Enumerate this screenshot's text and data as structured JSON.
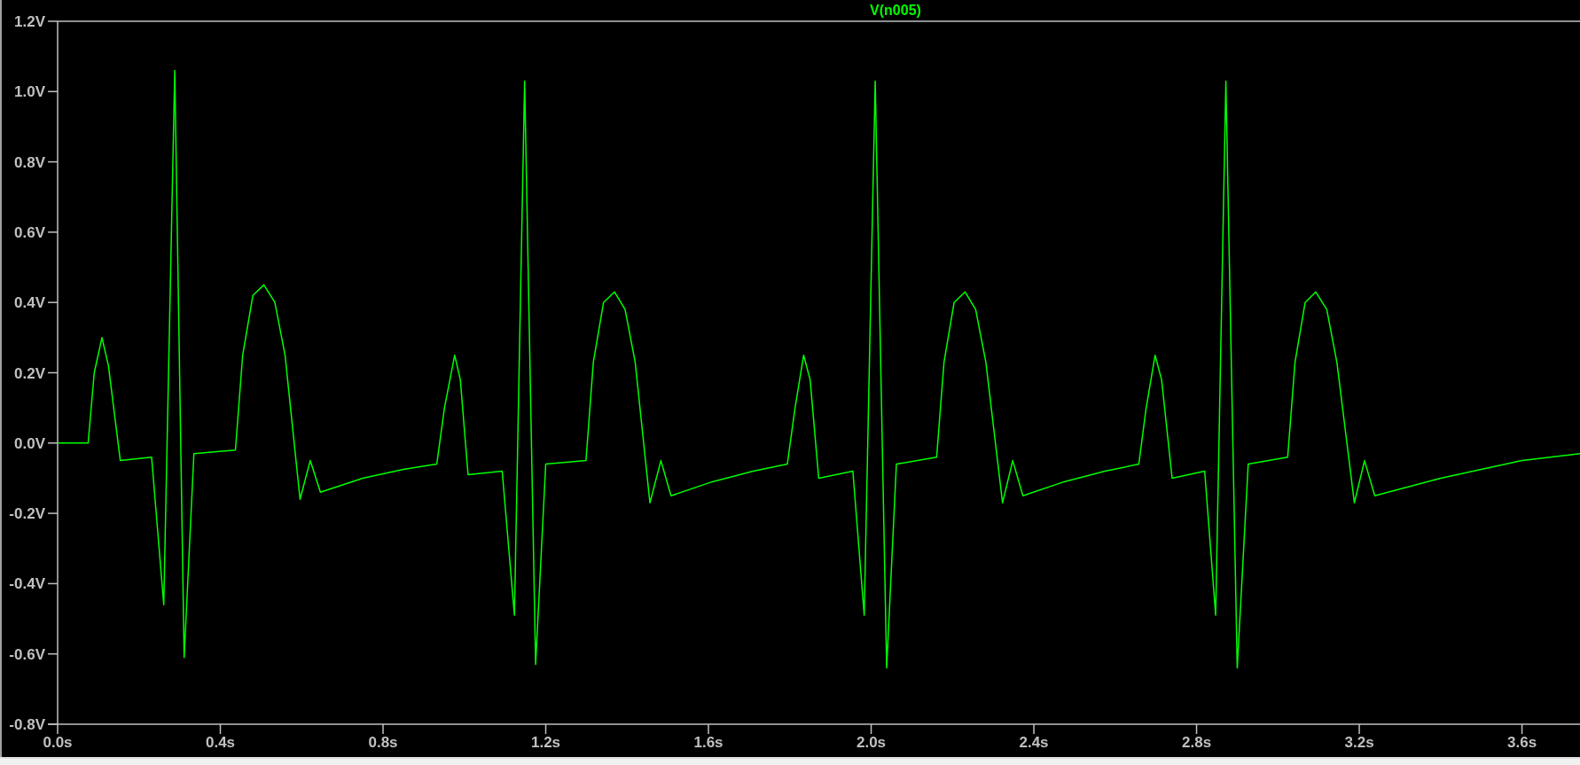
{
  "plot": {
    "chart_data": {
      "type": "line",
      "x": [
        0,
        0.075,
        0.09,
        0.109,
        0.125,
        0.154,
        0.231,
        0.261,
        0.288,
        0.311,
        0.335,
        0.437,
        0.455,
        0.48,
        0.507,
        0.534,
        0.559,
        0.596,
        0.621,
        0.646,
        0.75,
        0.85,
        0.932,
        0.951,
        0.976,
        0.99,
        1.009,
        1.093,
        1.123,
        1.148,
        1.175,
        1.2,
        1.299,
        1.317,
        1.342,
        1.369,
        1.395,
        1.42,
        1.456,
        1.483,
        1.508,
        1.61,
        1.71,
        1.794,
        1.813,
        1.834,
        1.85,
        1.871,
        1.955,
        1.983,
        2.01,
        2.038,
        2.062,
        2.161,
        2.179,
        2.204,
        2.231,
        2.257,
        2.282,
        2.323,
        2.348,
        2.373,
        2.475,
        2.575,
        2.658,
        2.676,
        2.698,
        2.714,
        2.74,
        2.82,
        2.847,
        2.872,
        2.9,
        2.927,
        3.024,
        3.042,
        3.067,
        3.093,
        3.12,
        3.145,
        3.188,
        3.213,
        3.238,
        3.4,
        3.6,
        3.745
      ],
      "series": [
        {
          "name": "V(n005)",
          "color": "#00ff00",
          "values": [
            0,
            0,
            0.2,
            0.3,
            0.22,
            -0.05,
            -0.04,
            -0.46,
            1.06,
            -0.61,
            -0.03,
            -0.02,
            0.25,
            0.42,
            0.45,
            0.4,
            0.25,
            -0.16,
            -0.05,
            -0.14,
            -0.1,
            -0.075,
            -0.06,
            0.1,
            0.25,
            0.18,
            -0.09,
            -0.08,
            -0.49,
            1.03,
            -0.63,
            -0.06,
            -0.05,
            0.23,
            0.4,
            0.43,
            0.38,
            0.23,
            -0.17,
            -0.05,
            -0.15,
            -0.11,
            -0.08,
            -0.06,
            0.1,
            0.25,
            0.18,
            -0.1,
            -0.08,
            -0.49,
            1.03,
            -0.64,
            -0.06,
            -0.04,
            0.23,
            0.4,
            0.43,
            0.38,
            0.23,
            -0.17,
            -0.05,
            -0.15,
            -0.11,
            -0.08,
            -0.06,
            0.1,
            0.25,
            0.18,
            -0.1,
            -0.08,
            -0.49,
            1.03,
            -0.64,
            -0.06,
            -0.04,
            0.23,
            0.4,
            0.43,
            0.38,
            0.23,
            -0.17,
            -0.05,
            -0.15,
            -0.1,
            -0.05,
            -0.03
          ]
        }
      ],
      "xlim": [
        0,
        3.747
      ],
      "ylim": [
        -0.8,
        1.2
      ],
      "xticks": [
        {
          "value": 0,
          "label": "0.0s"
        },
        {
          "value": 0.4,
          "label": "0.4s"
        },
        {
          "value": 0.8,
          "label": "0.8s"
        },
        {
          "value": 1.2,
          "label": "1.2s"
        },
        {
          "value": 1.6,
          "label": "1.6s"
        },
        {
          "value": 2.0,
          "label": "2.0s"
        },
        {
          "value": 2.4,
          "label": "2.4s"
        },
        {
          "value": 2.8,
          "label": "2.8s"
        },
        {
          "value": 3.2,
          "label": "3.2s"
        },
        {
          "value": 3.6,
          "label": "3.6s"
        }
      ],
      "yticks": [
        {
          "value": -0.8,
          "label": "-0.8V"
        },
        {
          "value": -0.6,
          "label": "-0.6V"
        },
        {
          "value": -0.4,
          "label": "-0.4V"
        },
        {
          "value": -0.2,
          "label": "-0.2V"
        },
        {
          "value": 0,
          "label": "0.0V"
        },
        {
          "value": 0.2,
          "label": "0.2V"
        },
        {
          "value": 0.4,
          "label": "0.4V"
        },
        {
          "value": 0.6,
          "label": "0.6V"
        },
        {
          "value": 0.8,
          "label": "0.8V"
        },
        {
          "value": 1.0,
          "label": "1.0V"
        },
        {
          "value": 1.2,
          "label": "1.2V"
        }
      ]
    }
  }
}
